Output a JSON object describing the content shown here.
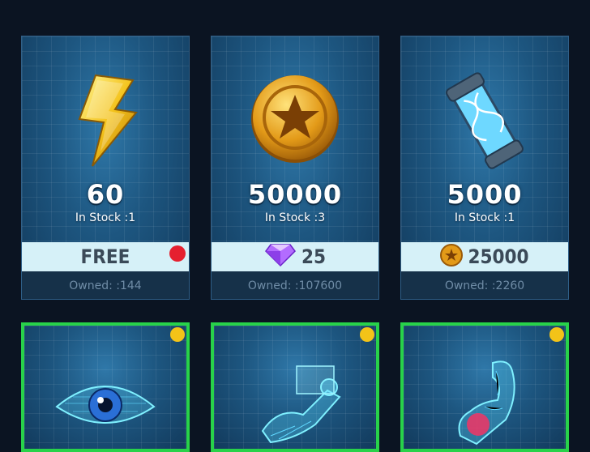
{
  "shop_items": [
    {
      "amount": "60",
      "stock": "In Stock :1",
      "price": "FREE",
      "price_type": "free",
      "owned": "Owned: :144",
      "icon": "lightning-icon",
      "has_red_dot": true
    },
    {
      "amount": "50000",
      "stock": "In Stock :3",
      "price": "25",
      "price_type": "gem",
      "owned": "Owned: :107600",
      "icon": "star-coin-icon"
    },
    {
      "amount": "5000",
      "stock": "In Stock :1",
      "price": "25000",
      "price_type": "coin",
      "owned": "Owned: :2260",
      "icon": "dna-canister-icon"
    }
  ],
  "upgrade_cards": [
    {
      "icon": "eye-hologram-icon",
      "badge": "yellow"
    },
    {
      "icon": "flying-hero-hologram-icon",
      "badge": "yellow"
    },
    {
      "icon": "flexing-arm-hologram-icon",
      "badge": "yellow"
    }
  ],
  "colors": {
    "accent_green": "#28d24a",
    "badge_yellow": "#f3c318",
    "alert_red": "#e5202f",
    "price_bar": "#d6f1f8"
  }
}
